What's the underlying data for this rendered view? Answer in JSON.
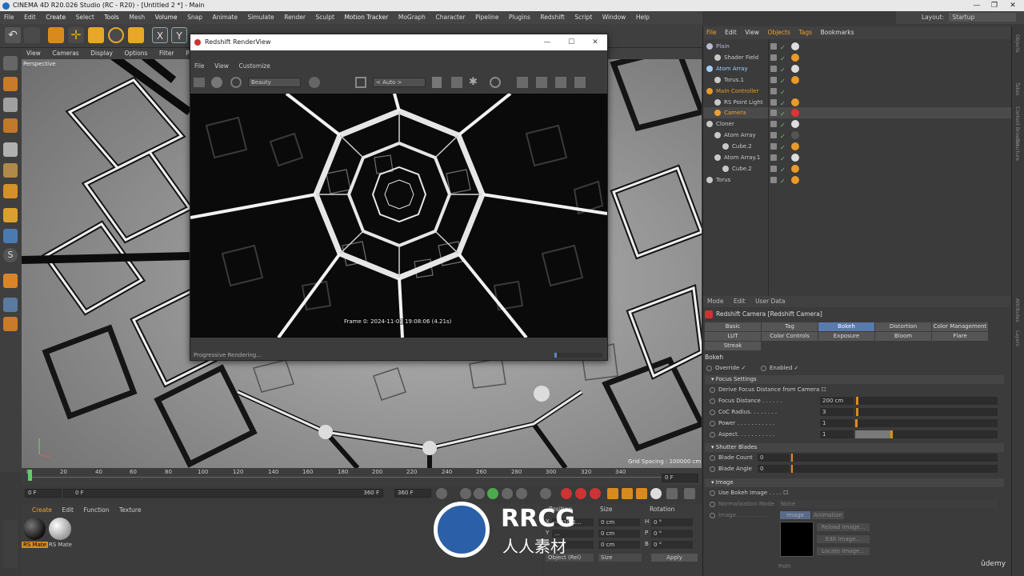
{
  "window": {
    "title": "CINEMA 4D R20.026 Studio (RC - R20) - [Untitled 2 *] - Main",
    "minimize": "—",
    "restore": "❐",
    "close": "✕"
  },
  "menubar": [
    "File",
    "Edit",
    "Create",
    "Select",
    "Tools",
    "Mesh",
    "Volume",
    "Snap",
    "Animate",
    "Simulate",
    "Render",
    "Sculpt",
    "Motion Tracker",
    "MoGraph",
    "Character",
    "Pipeline",
    "Plugins",
    "Redshift",
    "Script",
    "Window",
    "Help"
  ],
  "layout": {
    "label": "Layout:",
    "value": "Startup"
  },
  "viewport": {
    "menu": [
      "View",
      "Cameras",
      "Display",
      "Options",
      "Filter",
      "Panel"
    ],
    "label": "Perspective",
    "grid_info": "Grid Spacing : 100000 cm"
  },
  "renderview": {
    "title": "Redshift RenderView",
    "menu": [
      "File",
      "View",
      "Customize"
    ],
    "aov": "Beauty",
    "zoom": "< Auto >",
    "frame_info": "Frame  0:  2024-11-02  19:08:06  (4.21s)",
    "status": "Progressive Rendering..."
  },
  "timeline": {
    "ticks": [
      "0",
      "20",
      "40",
      "60",
      "80",
      "100",
      "120",
      "140",
      "160",
      "180",
      "200",
      "220",
      "240",
      "260",
      "280",
      "300",
      "320",
      "340"
    ],
    "current_right": "0 F",
    "start": "0 F",
    "min": "0 F",
    "max": "360 F",
    "end": "360 F"
  },
  "material_manager": {
    "menu": [
      "Create",
      "Edit",
      "Function",
      "Texture"
    ],
    "materials": [
      "RS Mate",
      "RS Mate"
    ]
  },
  "coordinates": {
    "headers": [
      "Position",
      "Size",
      "Rotation"
    ],
    "rows": [
      {
        "axis": "X",
        "pos": "-4810.1...",
        "size": "0 cm",
        "rot_axis": "H",
        "rot": "0 °"
      },
      {
        "axis": "Y",
        "pos": "...",
        "size": "0 cm",
        "rot_axis": "P",
        "rot": "0 °"
      },
      {
        "axis": "Z",
        "pos": "...",
        "size": "0 cm",
        "rot_axis": "B",
        "rot": "0 °"
      }
    ],
    "mode": "Object (Rel)",
    "size_mode": "Size",
    "apply": "Apply"
  },
  "object_manager": {
    "menu": [
      "File",
      "Edit",
      "View",
      "Objects",
      "Tags",
      "Bookmarks"
    ],
    "objects": [
      {
        "name": "Plain",
        "indent": 0,
        "color": "#b8b8d8"
      },
      {
        "name": "Shader Field",
        "indent": 1,
        "color": "#c8c8c8"
      },
      {
        "name": "Atom Array",
        "indent": 0,
        "color": "#9fd0ff"
      },
      {
        "name": "Torus.1",
        "indent": 1,
        "color": "#c8c8c8"
      },
      {
        "name": "Main Controller",
        "indent": 0,
        "color": "#e89a2a"
      },
      {
        "name": "RS Point Light",
        "indent": 1,
        "color": "#c8c8c8"
      },
      {
        "name": "Camera",
        "indent": 1,
        "color": "#f0a030"
      },
      {
        "name": "Cloner",
        "indent": 0,
        "color": "#c8c8c8"
      },
      {
        "name": "Atom Array",
        "indent": 1,
        "color": "#c8c8c8"
      },
      {
        "name": "Cube.2",
        "indent": 2,
        "color": "#c8c8c8"
      },
      {
        "name": "Atom Array.1",
        "indent": 1,
        "color": "#c8c8c8"
      },
      {
        "name": "Cube.2",
        "indent": 2,
        "color": "#c8c8c8"
      },
      {
        "name": "Torus",
        "indent": 0,
        "color": "#c8c8c8"
      }
    ]
  },
  "attribute_manager": {
    "menu": [
      "Mode",
      "Edit",
      "User Data"
    ],
    "object_title": "Redshift Camera [Redshift Camera]",
    "tabs_row1": [
      "Basic",
      "Tag",
      "Bokeh",
      "Distortion",
      "Color Management"
    ],
    "tabs_row2": [
      "LUT",
      "Color Controls",
      "Exposure",
      "Bloom",
      "Flare"
    ],
    "tabs_row3": [
      "Streak"
    ],
    "active_tab": "Bokeh",
    "section": "Bokeh",
    "override": "Override ✓",
    "enabled": "Enabled ✓",
    "focus_settings": "Focus Settings",
    "derive_focus": "Derive Focus Distance from Camera",
    "focus_distance": {
      "label": "Focus Distance . . . . . .",
      "value": "200 cm"
    },
    "coc_radius": {
      "label": "CoC Radius. . . . . . . .",
      "value": "3"
    },
    "power": {
      "label": "Power . . . . . . . . . . .",
      "value": "1"
    },
    "aspect": {
      "label": "Aspect. . . . . . . . . . .",
      "value": "1",
      "level": 0.5
    },
    "shutter_blades": "Shutter Blades",
    "blade_count": {
      "label": "Blade Count",
      "value": "0"
    },
    "blade_angle": {
      "label": "Blade Angle",
      "value": "0"
    },
    "image_section": "Image",
    "use_bokeh_image": "Use Bokeh Image . . . .",
    "normalization_mode": {
      "label": "Normalization Mode",
      "value": "None"
    },
    "image_label": "Image . . . . . . . . .",
    "image_tabs": [
      "Image",
      "Animation"
    ],
    "image_buttons": [
      "Reload Image...",
      "Edit Image...",
      "Locate Image..."
    ],
    "path_label": "Path"
  },
  "watermark": {
    "brand": "RRCG",
    "sub": "人人素材"
  },
  "udemy": "ûdemy"
}
